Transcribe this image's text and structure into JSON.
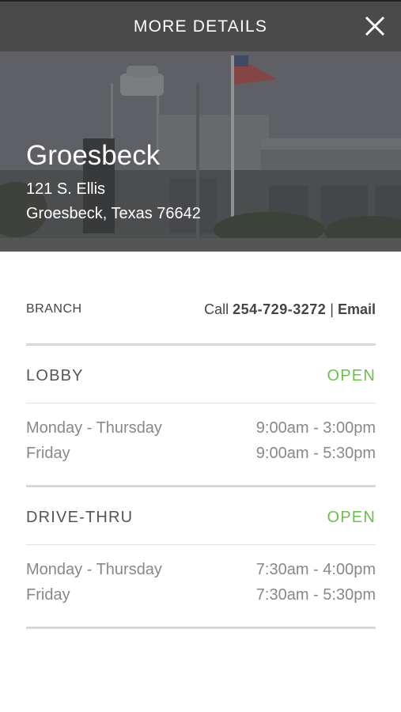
{
  "header": {
    "title": "MORE DETAILS",
    "close_icon": "close-icon"
  },
  "branch": {
    "name": "Groesbeck",
    "address_line1": "121 S. Ellis",
    "address_line2": "Groesbeck, Texas 76642",
    "label": "BRANCH",
    "call_prefix": "Call",
    "phone": "254-729-3272",
    "separator": "|",
    "email_label": "Email"
  },
  "lobby": {
    "title": "LOBBY",
    "status": "OPEN",
    "hours": [
      {
        "days": "Monday - Thursday",
        "time": "9:00am - 3:00pm"
      },
      {
        "days": "Friday",
        "time": "9:00am - 5:30pm"
      }
    ]
  },
  "drive_thru": {
    "title": "DRIVE-THRU",
    "status": "OPEN",
    "hours": [
      {
        "days": "Monday - Thursday",
        "time": "7:30am - 4:00pm"
      },
      {
        "days": "Friday",
        "time": "7:30am - 5:30pm"
      }
    ]
  },
  "colors": {
    "header_bg": "#4a4a4a",
    "open_status": "#6cc04a",
    "divider": "#d8d8d8"
  }
}
